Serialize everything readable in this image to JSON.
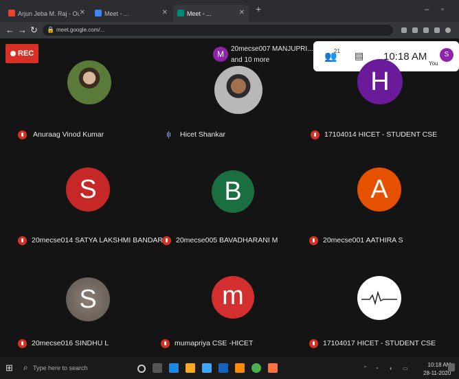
{
  "browser": {
    "tabs": [
      {
        "label": "Arjun Jeba M. Raj - Outl...",
        "icon": "gmail-icon",
        "color": "#ea4335",
        "active": false
      },
      {
        "label": "Meet - ...",
        "icon": "chrome-icon",
        "color": "#4285f4",
        "active": false
      },
      {
        "label": "Meet - ...",
        "icon": "meet-icon",
        "color": "#00897b",
        "active": true
      }
    ],
    "new_tab": "+",
    "url": "meet.google.com/..."
  },
  "meeting": {
    "rec_label": "REC",
    "banner": {
      "initial": "M",
      "line1": "20mecse007 MANJUPRI...",
      "line2": "and 10 more"
    },
    "panel": {
      "participant_count": "21",
      "time": "10:18 AM",
      "you_label": "You",
      "you_initial": "S"
    },
    "participants": [
      {
        "name": "Anuraag Vinod Kumar",
        "initial": "",
        "color": "#4f6a3f",
        "muted": true
      },
      {
        "name": "Hicet Shankar",
        "initial": "",
        "color": "#8c8c8c",
        "muted": false
      },
      {
        "name": "17104014 HICET - STUDENT CSE",
        "initial": "H",
        "color": "#6a1b9a",
        "muted": true
      },
      {
        "name": "20mecse014 SATYA LAKSHMI BANDARU",
        "initial": "S",
        "color": "#c62828",
        "muted": true
      },
      {
        "name": "20mecse005 BAVADHARANI M",
        "initial": "B",
        "color": "#1b6e3f",
        "muted": true
      },
      {
        "name": "20mecse001 AATHIRA S",
        "initial": "A",
        "color": "#e65100",
        "muted": true
      },
      {
        "name": "20mecse016 SINDHU L",
        "initial": "S",
        "color": "#7a7068",
        "muted": true
      },
      {
        "name": "mumapriya CSE -HICET",
        "initial": "m",
        "color": "#d32f2f",
        "muted": true
      },
      {
        "name": "17104017 HICET - STUDENT CSE",
        "initial": "",
        "color": "#ffffff",
        "muted": true
      }
    ]
  },
  "taskbar": {
    "search_placeholder": "Type here to search",
    "time": "10:18 AM",
    "date": "28-11-2020"
  }
}
